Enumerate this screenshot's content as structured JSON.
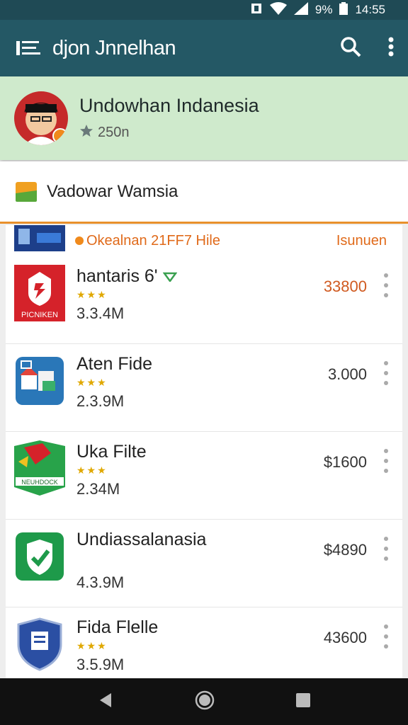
{
  "status": {
    "battery": "9%",
    "time": "14:55"
  },
  "app_bar": {
    "title": "djon Jnnelhan"
  },
  "profile": {
    "name": "Undowhan  Indanesia",
    "count": "250n"
  },
  "section": {
    "label": "Vadowar Wamsia"
  },
  "list": {
    "subhead_text": "Okealnan 21FF7 Hile",
    "subhead_right": "Isunuen",
    "items": [
      {
        "name": "hantaris 6'",
        "stars": "★★★",
        "size": "3.3.4M",
        "price": "33800",
        "icon_label": "PICNIKEN",
        "accent": "#d5222a"
      },
      {
        "name": "Aten Fide",
        "stars": "★★★",
        "size": "2.3.9M",
        "price": "3.000",
        "accent": "#2a77b8"
      },
      {
        "name": "Uka Filte",
        "stars": "★★★",
        "size": "2.34M",
        "price": "$1600",
        "icon_label": "NEUHDOCK",
        "accent": "#28a34a"
      },
      {
        "name": "Undiassalanasia",
        "stars": "",
        "size": "4.3.9M",
        "price": "$4890",
        "accent": "#1e9a4a"
      },
      {
        "name": "Fida Flelle",
        "stars": "★★★",
        "size": "3.5.9M",
        "price": "43600",
        "accent": "#2b4fa3"
      }
    ]
  },
  "colors": {
    "app_bar": "#245865",
    "profile_bg": "#cfeacc",
    "accent_orange": "#e8902c"
  }
}
